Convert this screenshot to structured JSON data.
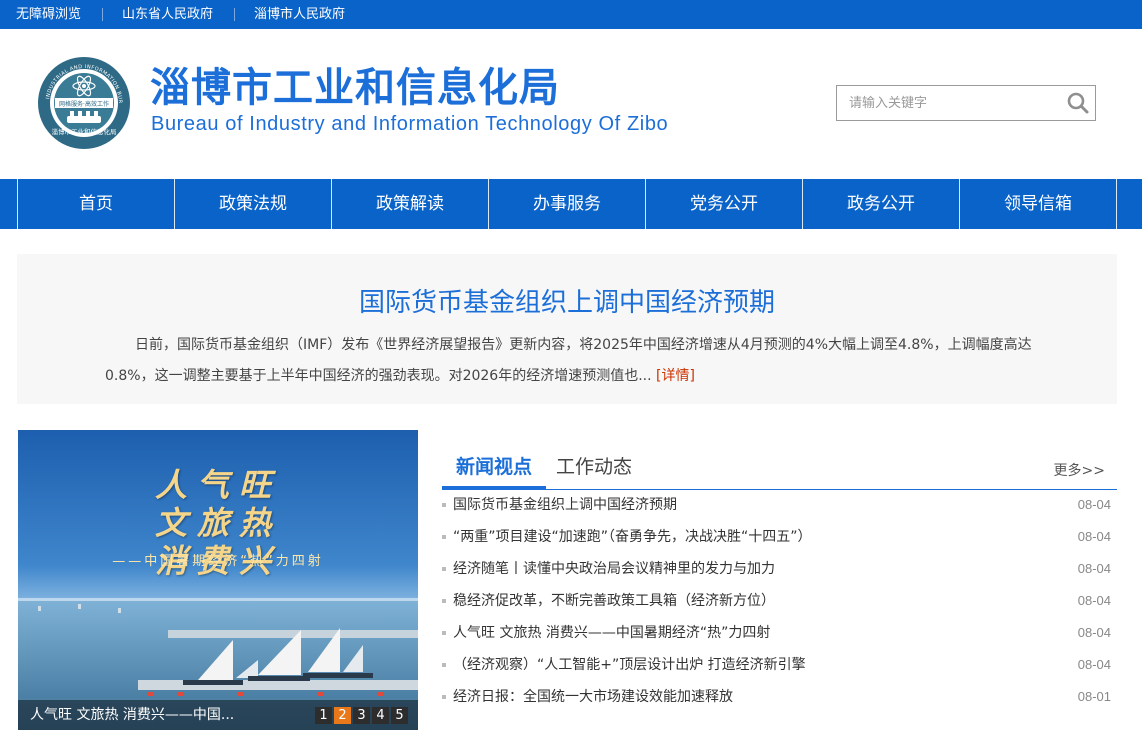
{
  "topbar": {
    "links": [
      "无障碍浏览",
      "山东省人民政府",
      "淄博市人民政府"
    ]
  },
  "header": {
    "logo_ring_text": "ZIBO INDUSTRIAL AND INFORMATION BUREAU",
    "logo_inner_text": "网格服务·高效工作",
    "logo_bottom_text": "淄博市工业和信息化局",
    "title_cn": "淄博市工业和信息化局",
    "title_en": "Bureau of Industry and Information Technology Of Zibo"
  },
  "search": {
    "placeholder": "请输入关键字",
    "icon": "search-icon"
  },
  "nav": {
    "items": [
      "首页",
      "政策法规",
      "政策解读",
      "办事服务",
      "党务公开",
      "政务公开",
      "领导信箱"
    ]
  },
  "headline": {
    "title": "国际货币基金组织上调中国经济预期",
    "body": "日前，国际货币基金组织（IMF）发布《世界经济展望报告》更新内容，将2025年中国经济增速从4月预测的4%大幅上调至4.8%，上调幅度高达0.8%，这一调整主要基于上半年中国经济的强劲表现。对2026年的经济增速预测值也...",
    "more": "[详情]"
  },
  "slideshow": {
    "art_line1": "人气旺",
    "art_line2": "文旅热",
    "art_line3": "消费兴",
    "art_sub": "——中国暑期经济“热”力四射",
    "caption": "人气旺 文旅热 消费兴——中国...",
    "pages": [
      "1",
      "2",
      "3",
      "4",
      "5"
    ],
    "active_page": 2
  },
  "news": {
    "tabs": [
      "新闻视点",
      "工作动态"
    ],
    "more": "更多>>",
    "items": [
      {
        "title": "国际货币基金组织上调中国经济预期",
        "date": "08-04"
      },
      {
        "title": "“两重”项目建设“加速跑”（奋勇争先，决战决胜“十四五”）",
        "date": "08-04"
      },
      {
        "title": "经济随笔丨读懂中央政治局会议精神里的发力与加力",
        "date": "08-04"
      },
      {
        "title": "稳经济促改革，不断完善政策工具箱（经济新方位）",
        "date": "08-04"
      },
      {
        "title": "人气旺 文旅热 消费兴——中国暑期经济“热”力四射",
        "date": "08-04"
      },
      {
        "title": "（经济观察）“人工智能+”顶层设计出炉 打造经济新引擎",
        "date": "08-04"
      },
      {
        "title": "经济日报：全国统一大市场建设效能加速释放",
        "date": "08-01"
      }
    ]
  },
  "colors": {
    "brand_blue": "#0a63c9",
    "title_blue": "#1c6fd8",
    "detail_red": "#cc3300",
    "pager_active": "#e8781a"
  }
}
